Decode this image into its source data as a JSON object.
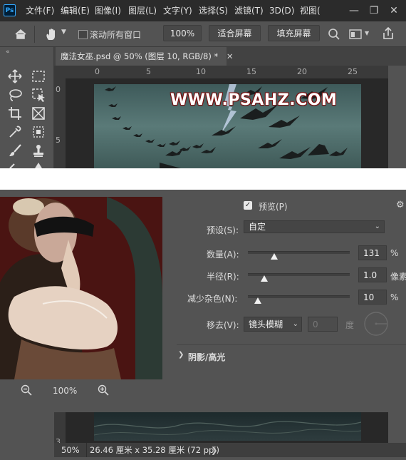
{
  "app": {
    "logo": "Ps"
  },
  "menu": [
    "文件(F)",
    "编辑(E)",
    "图像(I)",
    "图层(L)",
    "文字(Y)",
    "选择(S)",
    "滤镜(T)",
    "3D(D)",
    "视图("
  ],
  "options": {
    "scroll_all_label": "滚动所有窗口",
    "zoom_value": "100%",
    "fit_screen_label": "适合屏幕",
    "fill_screen_label": "填充屏幕"
  },
  "document": {
    "tab_title": "魔法女巫.psd @ 50% (图层 10, RGB/8) *",
    "watermark": "WWW.PSAHZ.COM",
    "ruler_h_ticks": [
      "0",
      "5",
      "10",
      "15",
      "20",
      "25"
    ],
    "ruler_v_ticks": [
      "0",
      "5"
    ]
  },
  "dialog": {
    "preview_label": "预览(P)",
    "preview_checked": true,
    "preset_label": "预设(S):",
    "preset_value": "自定",
    "amount_label": "数量(A):",
    "amount_value": "131",
    "amount_unit": "%",
    "amount_level": 0.26,
    "radius_label": "半径(R):",
    "radius_value": "1.0",
    "radius_unit": "像素",
    "radius_level": 0.16,
    "noise_label": "减少杂色(N):",
    "noise_value": "10",
    "noise_unit": "%",
    "noise_level": 0.1,
    "remove_label": "移去(V):",
    "remove_value": "镜头模糊",
    "angle_value": "0",
    "angle_unit": "度",
    "shadows_label": "阴影/高光",
    "zoom_value": "100%"
  },
  "status": {
    "zoom": "50%",
    "doc_size": "26.46 厘米 x 35.28 厘米 (72 ppi)",
    "ruler_v_bottom": "3"
  },
  "colors": {
    "accent": "#31a8ff",
    "menubar": "#2b2b2b",
    "panel": "#535353"
  }
}
